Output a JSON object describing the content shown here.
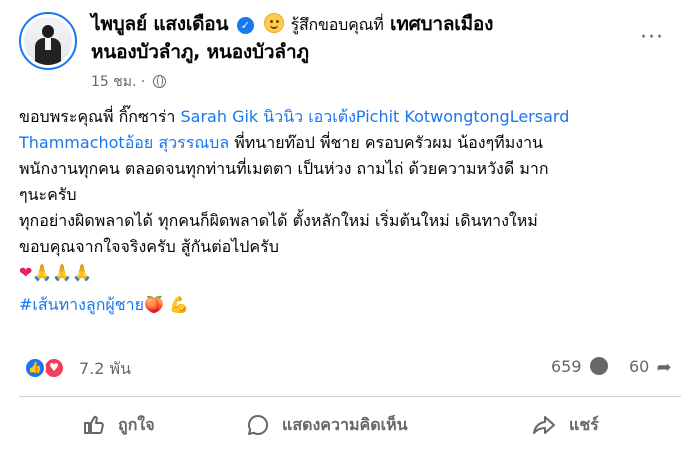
{
  "header": {
    "author": "ไพบูลย์ แสงเดือน",
    "feeling": "รู้สึกขอบคุณที่",
    "place_line1": "เทศบาลเมือง",
    "place_line2": "หนองบัวลำภู, หนองบัวลำภู",
    "time": "15 ชม.",
    "dot": "·",
    "more": "···"
  },
  "body": {
    "line1_text": "ขอบพระคุณพี่ กิ๊กซาร่า ",
    "line1_link": "Sarah Gik นิวนิว เอวเต้งPichit KotwongtongLersard",
    "line2_link": "Thammachotอ้อย สุวรรณบล",
    "line2_text": " พี่ทนายท๊อป พี่ชาย ครอบครัวผม น้องๆทีมงาน",
    "line3": "พนักงานทุกคน ตลอดจนทุกท่านที่เมตตา เป็นห่วง ถามไถ่ ด้วยความหวังดี มาก",
    "line4": "ๆนะครับ",
    "line5": "ทุกอย่างผิดพลาดได้ ทุกคนก็ผิดพลาดได้ ตั้งหลักใหม่ เริ่มต้นใหม่ เดินทางใหม่",
    "line6": "ขอบคุณจากใจจริงครับ สู้กันต่อไปครับ",
    "emoji_heart": "❤",
    "emoji_pray": "🙏🙏🙏",
    "hashtag": "#เส้นทางลูกผู้ชาย",
    "hashtag_emoji": "🍑 💪"
  },
  "stats": {
    "reactions": "7.2 พัน",
    "comments": "659",
    "shares": "60"
  },
  "actions": {
    "like": "ถูกใจ",
    "comment": "แสดงความคิดเห็น",
    "share": "แชร์"
  },
  "colors": {
    "link": "#1877f2",
    "secondary_text": "#65676b",
    "like_blue": "#1877f2",
    "love_red": "#f33e58"
  }
}
